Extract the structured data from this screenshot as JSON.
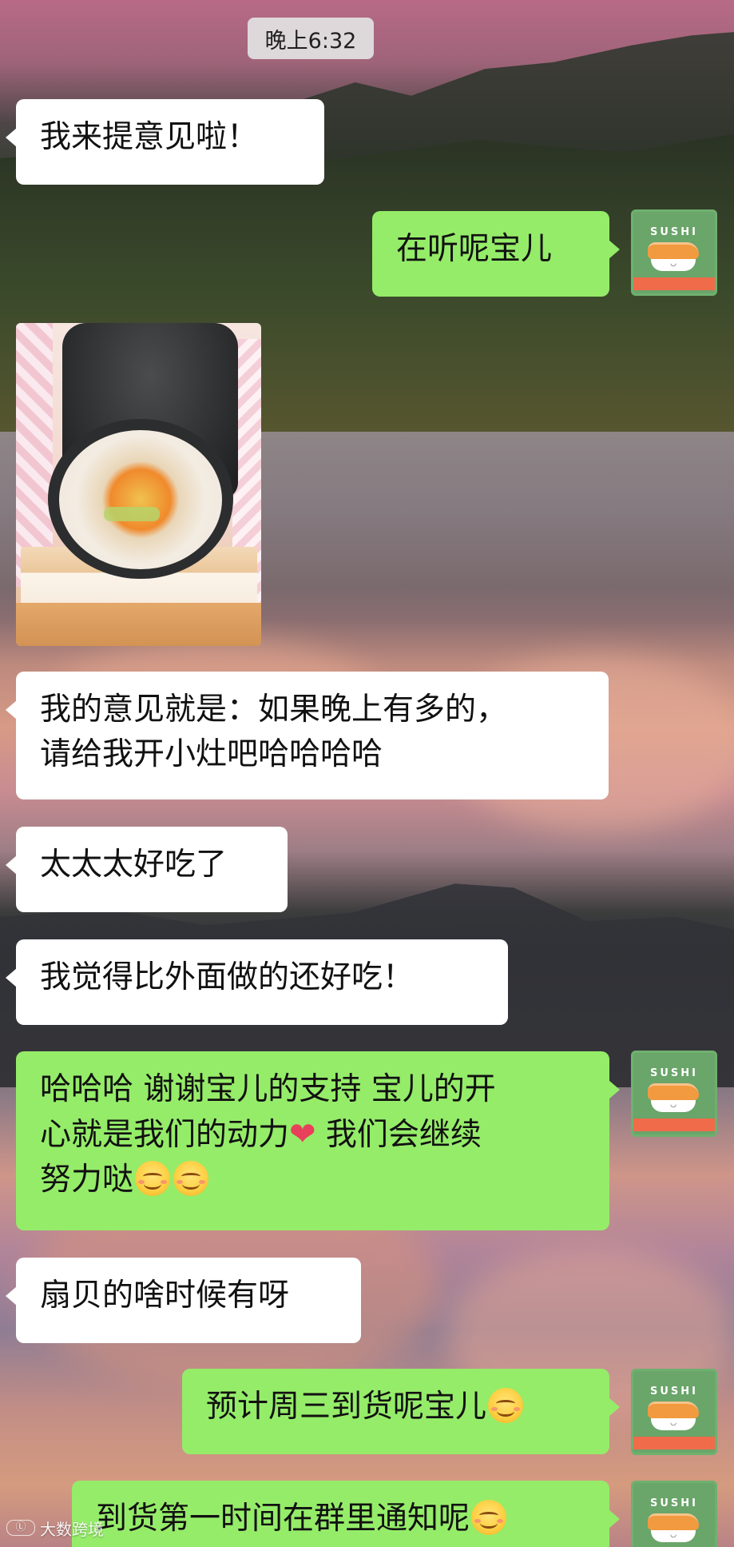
{
  "timestamp": "晚上6:32",
  "messages": [
    {
      "side": "in",
      "text": "我来提意见啦！"
    },
    {
      "side": "out",
      "text": "在听呢宝儿"
    },
    {
      "side": "in",
      "type": "image",
      "alt": "sushi-roll-photo"
    },
    {
      "side": "in",
      "text": "我的意见就是：如果晚上有多的，\n请给我开小灶吧哈哈哈哈"
    },
    {
      "side": "in",
      "text": "太太太好吃了"
    },
    {
      "side": "in",
      "text": "我觉得比外面做的还好吃！"
    },
    {
      "side": "out",
      "text_parts": [
        "哈哈哈 谢谢宝儿的支持 宝儿的开\n心就是我们的动力",
        "heart",
        " 我们会继续\n努力哒",
        "smile",
        "smile"
      ]
    },
    {
      "side": "in",
      "text": "扇贝的啥时候有呀"
    },
    {
      "side": "out",
      "text": "预计周三到货呢宝儿",
      "emoji": "smile"
    },
    {
      "side": "out",
      "text": "到货第一时间在群里通知呢",
      "emoji": "smile"
    }
  ],
  "msg_texts": {
    "m1": "我来提意见啦！",
    "m2": "在听呢宝儿",
    "m4": "我的意见就是：如果晚上有多的，\n请给我开小灶吧哈哈哈哈",
    "m5": "太太太好吃了",
    "m6": "我觉得比外面做的还好吃！",
    "m7a": "哈哈哈 谢谢宝儿的支持 宝儿的开\n心就是我们的动力",
    "m7b": " 我们会继续\n努力哒",
    "m8": "扇贝的啥时候有呀",
    "m9": "预计周三到货呢宝儿",
    "m10": "到货第一时间在群里通知呢"
  },
  "avatar": {
    "brand": "SUSHI",
    "icon": "sushi-avatar-icon",
    "colors": {
      "bg": "#6aa56a",
      "banner": "#f06b4a"
    }
  },
  "colors": {
    "bubble_in": "#ffffff",
    "bubble_out": "#95ec69",
    "time_pill": "#e2e2e2"
  },
  "icons": {
    "heart": "heart-icon",
    "smile": "smile-emoji-icon"
  },
  "watermark": "大数跨境"
}
